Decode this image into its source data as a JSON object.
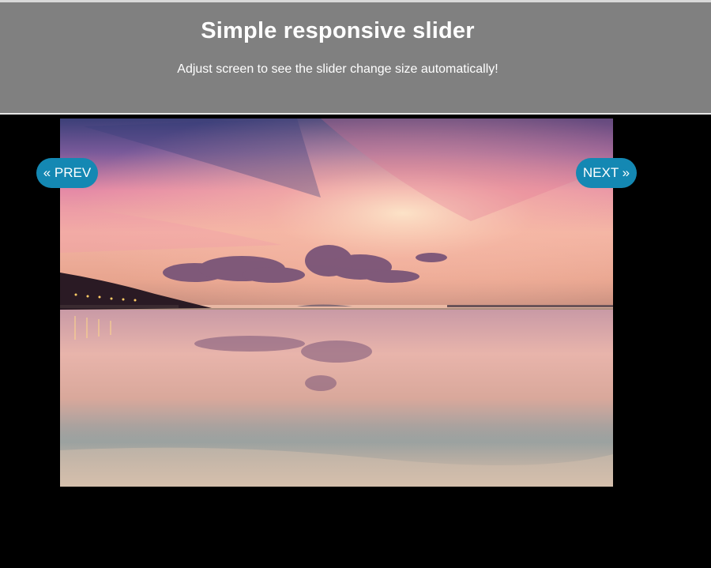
{
  "header": {
    "title": "Simple responsive slider",
    "subtitle": "Adjust screen to see the slider change size automatically!"
  },
  "slider": {
    "prev_label": "« PREV",
    "next_label": "NEXT »",
    "current_slide": {
      "image": "sunset-sea-pier-reflection"
    }
  },
  "colors": {
    "header_bg": "#808080",
    "page_bg": "#000000",
    "button_bg": "#1488b3"
  }
}
